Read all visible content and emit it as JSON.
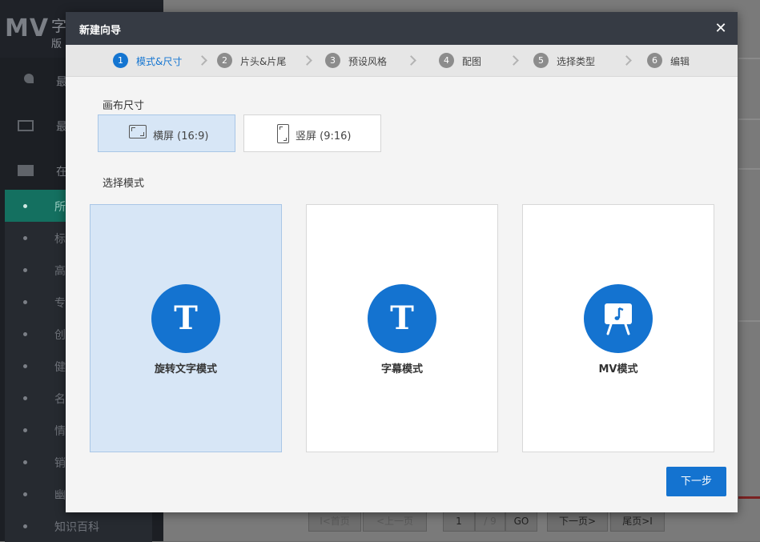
{
  "background": {
    "logo_text": "MV",
    "logo_line1": "字",
    "logo_line2": "版",
    "menu": [
      {
        "label": "最"
      },
      {
        "label": "最"
      },
      {
        "label": "在"
      }
    ],
    "submenu": [
      {
        "label": "所"
      },
      {
        "label": "标"
      },
      {
        "label": "高"
      },
      {
        "label": "专"
      },
      {
        "label": "创"
      },
      {
        "label": "健"
      },
      {
        "label": "名"
      },
      {
        "label": "情"
      },
      {
        "label": "销"
      },
      {
        "label": "幽"
      },
      {
        "label": "知识百科"
      }
    ],
    "pager": {
      "first": "I<首页",
      "prev": "<上一页",
      "page": "1",
      "total": "/ 9",
      "go": "GO",
      "next": "下一页>",
      "last": "尾页>I"
    }
  },
  "modal": {
    "title": "新建向导",
    "close_icon": "close-icon",
    "steps": [
      {
        "num": "1",
        "label": "模式&尺寸"
      },
      {
        "num": "2",
        "label": "片头&片尾"
      },
      {
        "num": "3",
        "label": "预设风格"
      },
      {
        "num": "4",
        "label": "配图"
      },
      {
        "num": "5",
        "label": "选择类型"
      },
      {
        "num": "6",
        "label": "编辑"
      }
    ],
    "active_step": 1,
    "canvas_size_label": "画布尺寸",
    "canvas_options": [
      {
        "label": "横屏 (16:9)",
        "icon": "landscape-icon",
        "selected": true
      },
      {
        "label": "竖屏 (9:16)",
        "icon": "portrait-icon",
        "selected": false
      }
    ],
    "mode_label": "选择模式",
    "modes": [
      {
        "name": "旋转文字模式",
        "icon": "T",
        "selected": true
      },
      {
        "name": "字幕模式",
        "icon": "T",
        "selected": false
      },
      {
        "name": "MV模式",
        "icon": "easel-music-icon",
        "selected": false
      }
    ],
    "next_button": "下一步",
    "accent_color": "#1473d0",
    "selected_bg": "#d7e6f6",
    "header_color": "#363b44"
  }
}
